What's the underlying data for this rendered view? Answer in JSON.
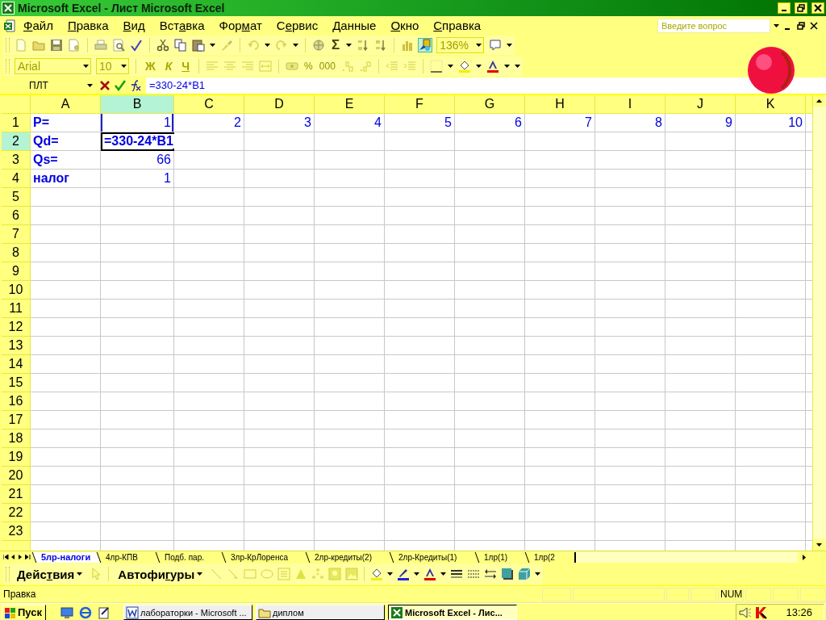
{
  "window": {
    "title": "Microsoft Excel - Лист Microsoft Excel"
  },
  "menu": [
    {
      "key": "Ф",
      "post": "айл"
    },
    {
      "key": "П",
      "post": "равка"
    },
    {
      "key": "В",
      "post": "ид"
    },
    {
      "pre": "Вст",
      "key": "а",
      "post": "вка"
    },
    {
      "pre": "Фор",
      "key": "м",
      "post": "ат"
    },
    {
      "pre": "С",
      "key": "е",
      "post": "рвис"
    },
    {
      "key": "Д",
      "post": "анные"
    },
    {
      "key": "О",
      "post": "кно"
    },
    {
      "key": "С",
      "post": "правка"
    }
  ],
  "help_search": {
    "placeholder": "Введите вопрос"
  },
  "standard_toolbar": {
    "sum_label": "Σ",
    "zoom": {
      "value": "136%",
      "disabled": true
    }
  },
  "formatting_toolbar": {
    "font": {
      "value": "Arial",
      "disabled": true
    },
    "size": {
      "value": "10",
      "disabled": true
    },
    "style_buttons": [
      {
        "label": "Ж",
        "disabled": true
      },
      {
        "label": "К",
        "disabled": true
      },
      {
        "label": "Ч",
        "disabled": true
      }
    ],
    "number_buttons": [
      {
        "label": "%"
      },
      {
        "label": "000"
      }
    ]
  },
  "formula_bar": {
    "name_box": "ПЛТ",
    "formula": "=330-24*B1"
  },
  "sheet": {
    "columns": [
      {
        "label": "A",
        "selected": false
      },
      {
        "label": "B",
        "selected": true
      },
      {
        "label": "C",
        "selected": false
      },
      {
        "label": "D",
        "selected": false
      },
      {
        "label": "E",
        "selected": false
      },
      {
        "label": "F",
        "selected": false
      },
      {
        "label": "G",
        "selected": false
      },
      {
        "label": "H",
        "selected": false
      },
      {
        "label": "I",
        "selected": false
      },
      {
        "label": "J",
        "selected": false
      },
      {
        "label": "K",
        "selected": false
      }
    ],
    "rows": [
      {
        "label": "1",
        "selected": false,
        "cells": [
          {
            "text": "P=",
            "kind": "label",
            "selected": false
          },
          {
            "text": "1",
            "kind": "number",
            "selected": false,
            "referenced": true
          },
          {
            "text": "2",
            "kind": "number",
            "selected": false
          },
          {
            "text": "3",
            "kind": "number",
            "selected": false
          },
          {
            "text": "4",
            "kind": "number",
            "selected": false
          },
          {
            "text": "5",
            "kind": "number",
            "selected": false
          },
          {
            "text": "6",
            "kind": "number",
            "selected": false
          },
          {
            "text": "7",
            "kind": "number",
            "selected": false
          },
          {
            "text": "8",
            "kind": "number",
            "selected": false
          },
          {
            "text": "9",
            "kind": "number",
            "selected": false
          },
          {
            "text": "10",
            "kind": "number",
            "selected": false
          }
        ]
      },
      {
        "label": "2",
        "selected": true,
        "cells": [
          {
            "text": "Qd=",
            "kind": "label",
            "selected": false
          },
          {
            "text": "=330-24*B1",
            "kind": "editing",
            "selected": true
          }
        ]
      },
      {
        "label": "3",
        "selected": false,
        "cells": [
          {
            "text": "Qs=",
            "kind": "label",
            "selected": false
          },
          {
            "text": "66",
            "kind": "number",
            "selected": false
          }
        ]
      },
      {
        "label": "4",
        "selected": false,
        "cells": [
          {
            "text": "налог",
            "kind": "label",
            "selected": false
          },
          {
            "text": "1",
            "kind": "number",
            "selected": false
          }
        ]
      },
      {
        "label": "5",
        "selected": false
      },
      {
        "label": "6",
        "selected": false
      },
      {
        "label": "7",
        "selected": false
      },
      {
        "label": "8",
        "selected": false
      },
      {
        "label": "9",
        "selected": false
      },
      {
        "label": "10",
        "selected": false
      },
      {
        "label": "11",
        "selected": false
      },
      {
        "label": "12",
        "selected": false
      },
      {
        "label": "13",
        "selected": false
      },
      {
        "label": "14",
        "selected": false
      },
      {
        "label": "15",
        "selected": false
      },
      {
        "label": "16",
        "selected": false
      },
      {
        "label": "17",
        "selected": false
      },
      {
        "label": "18",
        "selected": false
      },
      {
        "label": "19",
        "selected": false
      },
      {
        "label": "20",
        "selected": false
      },
      {
        "label": "21",
        "selected": false
      },
      {
        "label": "22",
        "selected": false
      },
      {
        "label": "23",
        "selected": false
      }
    ]
  },
  "sheet_tabs": [
    {
      "label": "5лр-налоги",
      "selected": true
    },
    {
      "label": "4лр-КПВ",
      "selected": false
    },
    {
      "label": "Подб. пар.",
      "selected": false
    },
    {
      "label": "3лр-КрЛоренса",
      "selected": false
    },
    {
      "label": "2лр-кредиты(2)",
      "selected": false
    },
    {
      "label": "2лр-Кредиты(1)",
      "selected": false
    },
    {
      "label": "1лр(1)",
      "selected": false
    },
    {
      "label": "1лр(2",
      "selected": false
    }
  ],
  "drawing_toolbar": {
    "menus": [
      {
        "pre": "Дейс",
        "key": "т",
        "post": "вия"
      },
      {
        "pre": "Автофи",
        "key": "г",
        "post": "уры"
      }
    ]
  },
  "status_bar": {
    "mode": "Правка",
    "indicator": "NUM"
  },
  "taskbar": {
    "start": "Пуск",
    "tasks": [
      {
        "label": "лабораторки - Microsoft ...",
        "kind": "word",
        "selected": false
      },
      {
        "label": "диплом",
        "kind": "folder",
        "selected": false
      },
      {
        "label": "Microsoft Excel - Лис...",
        "kind": "excel",
        "selected": true
      }
    ],
    "clock": "13:26"
  }
}
